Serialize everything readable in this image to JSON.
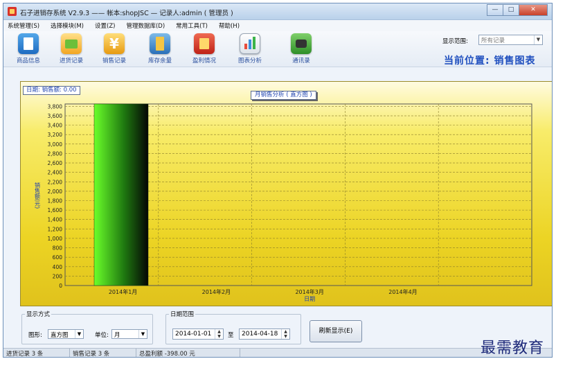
{
  "window": {
    "title": "石子进销存系统 V2.9.3 —— 帐本:shopJSC — 记录人:admin ( 管理员 )",
    "min": "—",
    "max": "□",
    "close": "✕"
  },
  "menu": [
    "系统管理(S)",
    "选择模块(M)",
    "设置(Z)",
    "管理数据库(D)",
    "常用工具(T)",
    "帮助(H)"
  ],
  "toolbar": {
    "tools": [
      "商品信息",
      "进货记录",
      "销售记录",
      "库存余量",
      "盈利情况",
      "图表分析",
      "通讯录"
    ],
    "range_label": "显示范围:",
    "range_value": "所有记录",
    "location": "当前位置: 销售图表"
  },
  "chart_info": {
    "date_box": "日期:  销售额: 0.00",
    "title": "月销售分析 ( 直方图 )"
  },
  "chart_data": {
    "type": "bar",
    "title": "月销售分析 ( 直方图 )",
    "xlabel": "日期",
    "ylabel": "销售额(元)",
    "categories": [
      "2014年1月",
      "2014年2月",
      "2014年3月",
      "2014年4月"
    ],
    "values": [
      3850,
      0,
      0,
      0
    ],
    "ylim": [
      0,
      3850
    ],
    "yticks": [
      0,
      200,
      400,
      600,
      800,
      1000,
      1200,
      1400,
      1600,
      1800,
      2000,
      2200,
      2400,
      2600,
      2800,
      3000,
      3200,
      3400,
      3600,
      3800
    ],
    "ytick_labels": [
      "0",
      "200",
      "400",
      "600",
      "800",
      "1,000",
      "1,200",
      "1,400",
      "1,600",
      "1,800",
      "2,000",
      "2,200",
      "2,400",
      "2,600",
      "2,800",
      "3,000",
      "3,200",
      "3,400",
      "3,600",
      "3,800"
    ],
    "grid": true,
    "colors": {
      "bar_top": "#6bff2a",
      "bar_bottom": "#050505"
    }
  },
  "controls": {
    "display_group": "显示方式",
    "shape_label": "图形:",
    "shape_value": "直方图",
    "unit_label": "单位:",
    "unit_value": "月",
    "date_group": "日期范围",
    "date_from": "2014-01-01",
    "to_label": "至",
    "date_to": "2014-04-18",
    "refresh": "刷新显示(E)"
  },
  "status": [
    "进货记录 3 条",
    "销售记录 3 条",
    "总盈利额 -398.00 元"
  ],
  "watermark": "最需教育"
}
